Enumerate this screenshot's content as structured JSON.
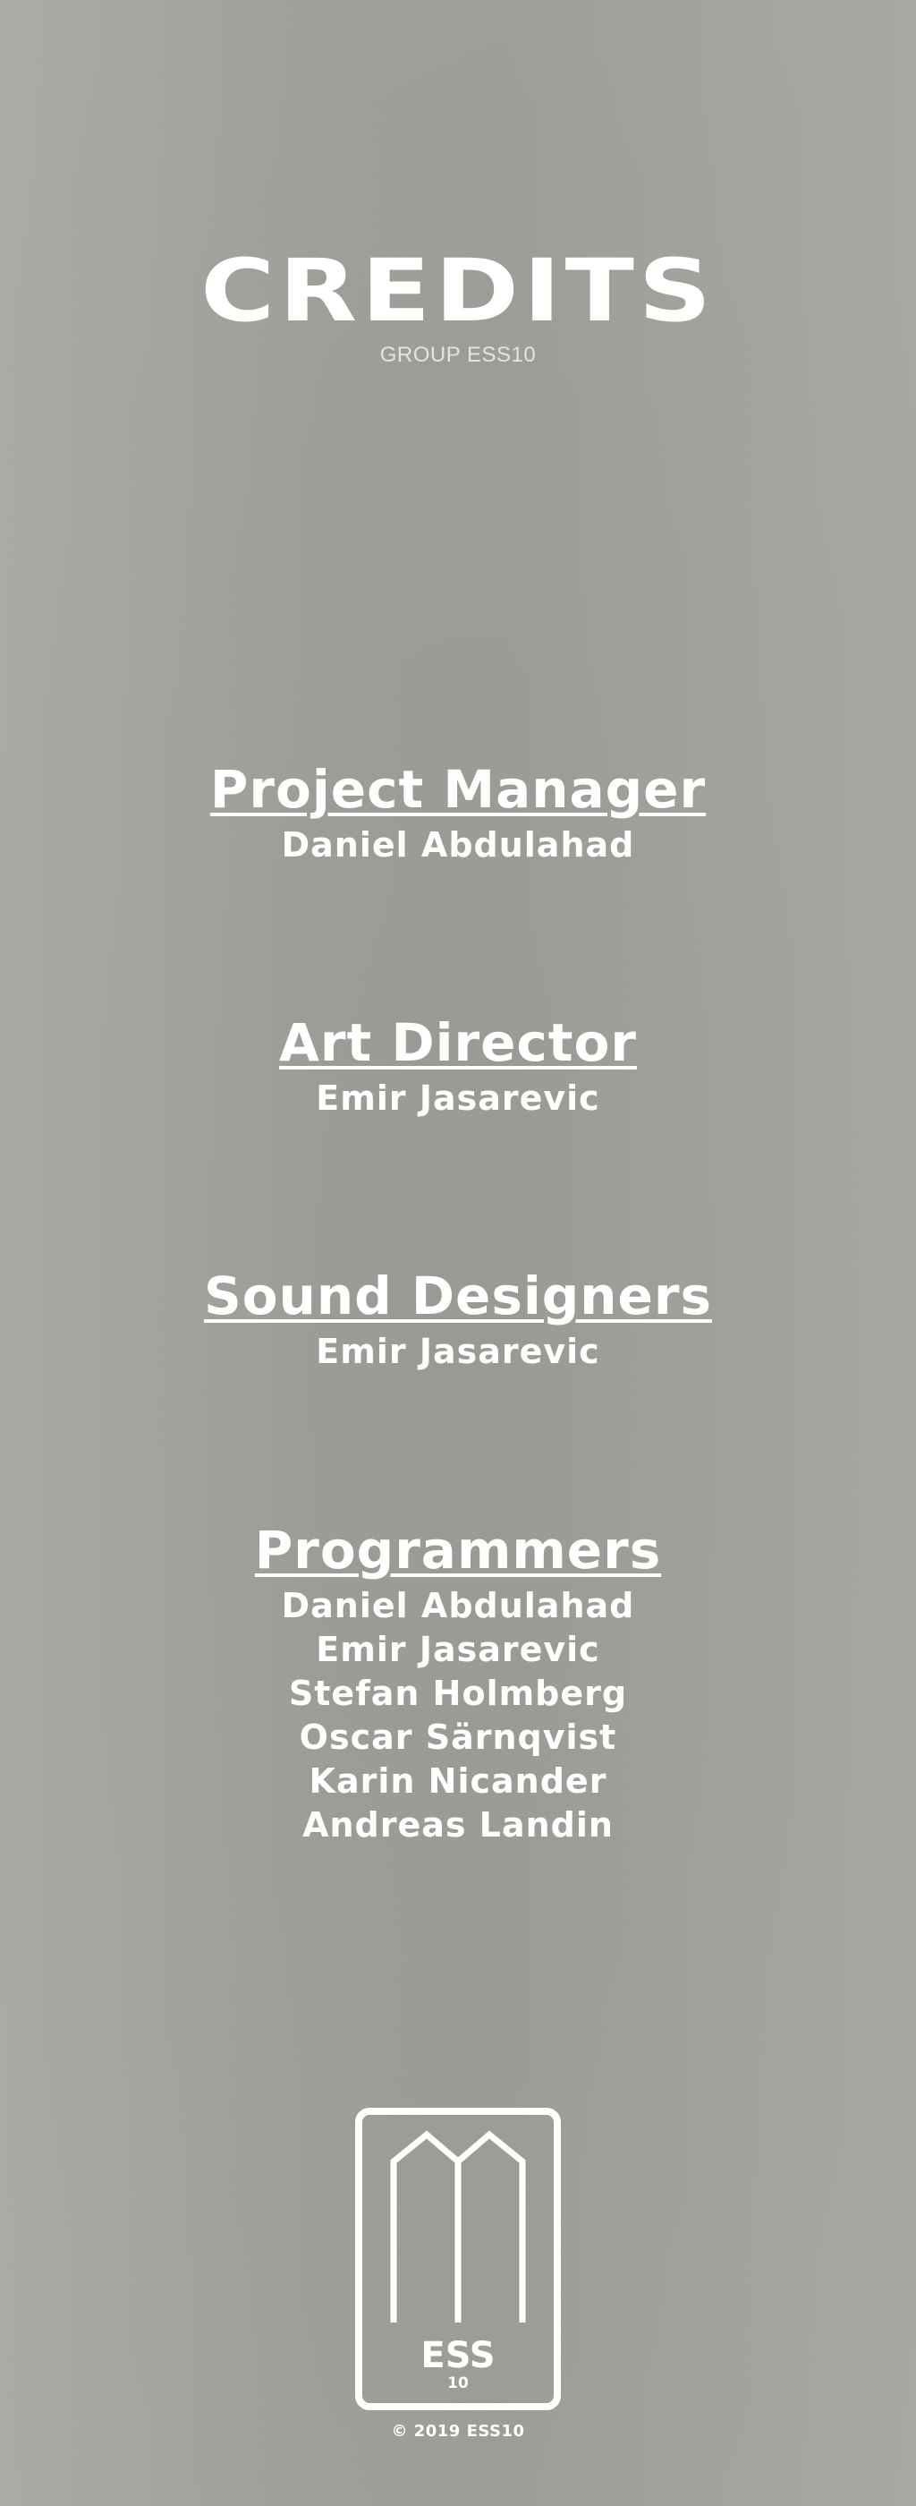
{
  "header": {
    "title": "CREDITS",
    "subtitle": "GROUP ESS10"
  },
  "sections": [
    {
      "role": "Project Manager",
      "names": [
        "Daniel Abdulahad"
      ]
    },
    {
      "role": "Art Director",
      "names": [
        "Emir Jasarevic"
      ]
    },
    {
      "role": "Sound Designers",
      "names": [
        "Emir Jasarevic"
      ]
    },
    {
      "role": "Programmers",
      "names": [
        "Daniel Abdulahad",
        "Emir Jasarevic",
        "Stefan Holmberg",
        "Oscar Särnqvist",
        "Karin Nicander",
        "Andreas Landin"
      ]
    }
  ],
  "logo": {
    "text": "ESS",
    "number": "10",
    "icon": "ess10-building-logo-icon"
  },
  "footer": {
    "copyright": "© 2019 ESS10"
  },
  "colors": {
    "text": "#ffffff",
    "background": "#9d9c96"
  }
}
